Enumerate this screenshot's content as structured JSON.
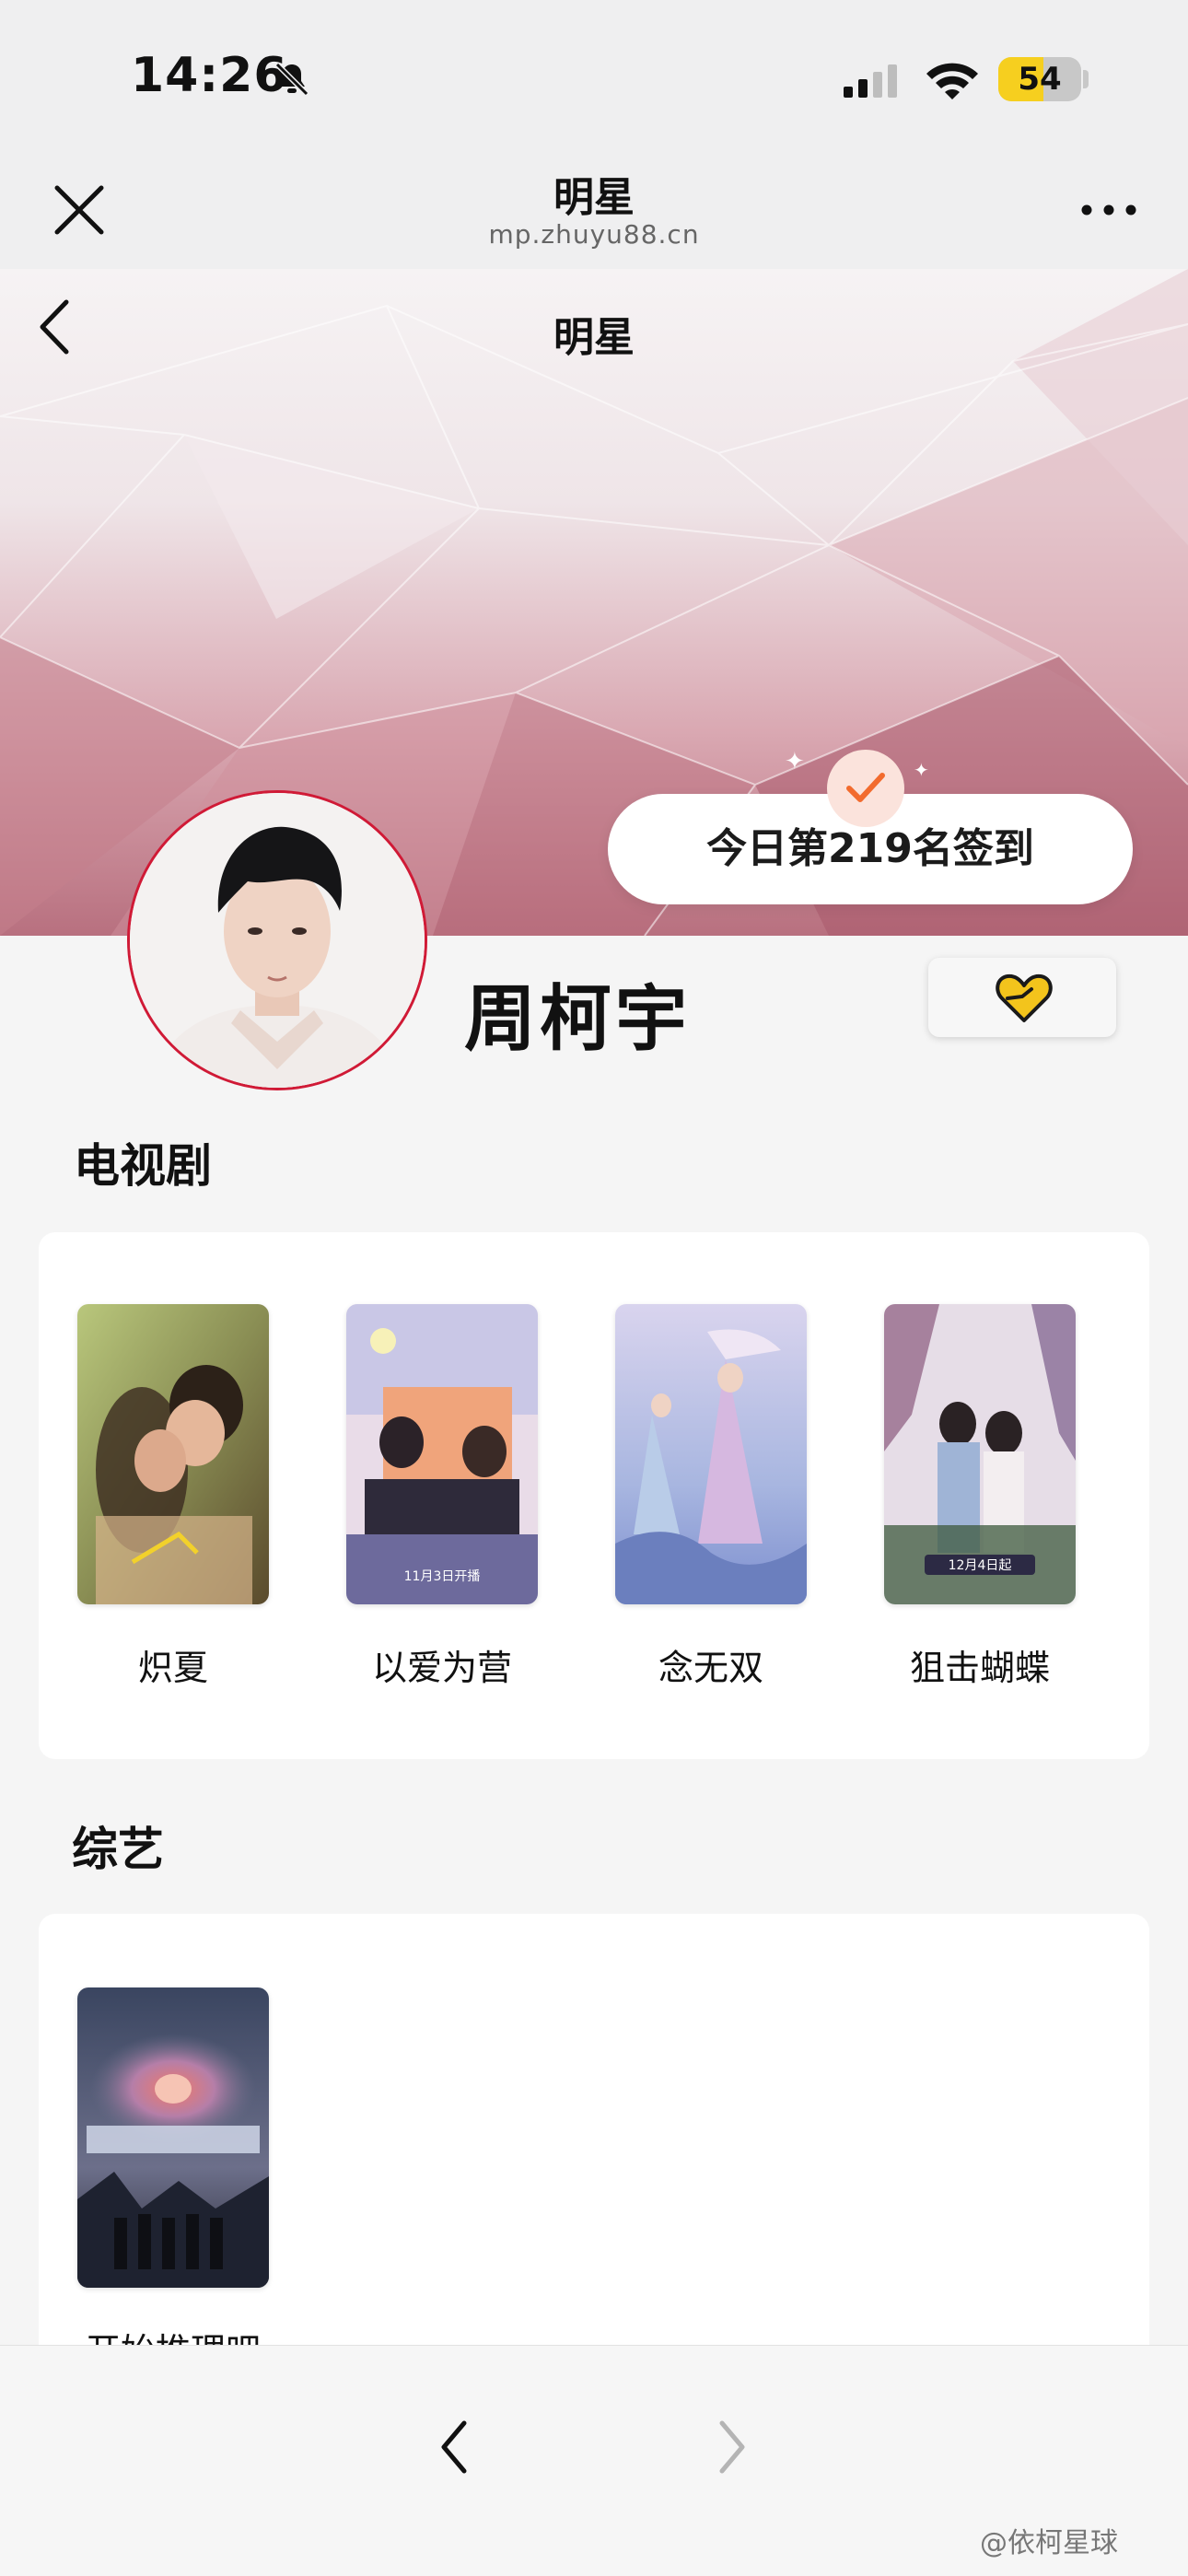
{
  "status_bar": {
    "time": "14:26",
    "battery": "54",
    "battery_fraction": 0.54
  },
  "mp_nav": {
    "title": "明星",
    "domain": "mp.zhuyu88.cn"
  },
  "header": {
    "title": "明星"
  },
  "checkin": {
    "label": "今日第219名签到"
  },
  "profile": {
    "name": "周柯宇"
  },
  "sections": [
    {
      "title": "电视剧",
      "items": [
        {
          "label": "炽夏"
        },
        {
          "label": "以爱为营"
        },
        {
          "label": "念无双"
        },
        {
          "label": "狙击蝴蝶"
        }
      ]
    },
    {
      "title": "综艺",
      "items": [
        {
          "label": "开始推理吧"
        }
      ]
    }
  ],
  "watermark": "@依柯星球",
  "colors": {
    "accent": "#d01a36",
    "checkmark": "#f26b2e",
    "heart": "#f3c41c",
    "battery": "#f6cf1f"
  }
}
